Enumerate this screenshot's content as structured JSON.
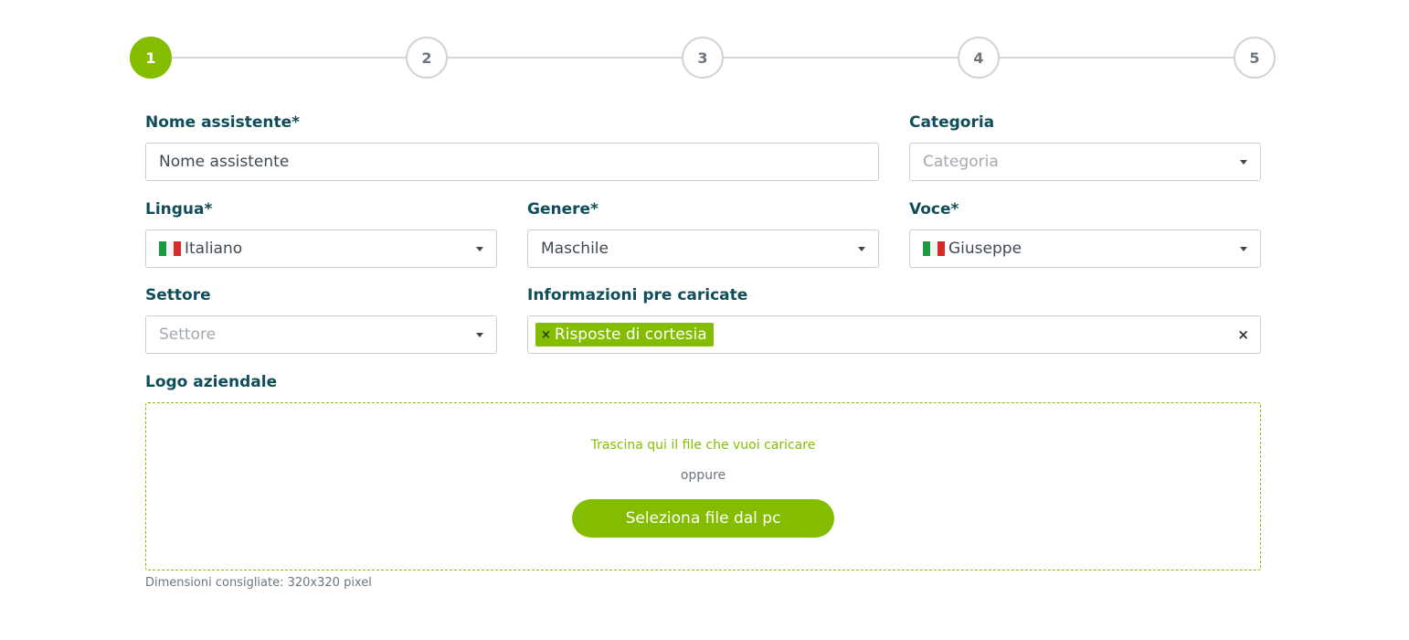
{
  "stepper": {
    "steps": [
      "1",
      "2",
      "3",
      "4",
      "5"
    ],
    "active_step": 1,
    "accent_color": "#84bd00"
  },
  "form": {
    "nome": {
      "label": "Nome assistente*",
      "value": "Nome assistente"
    },
    "categoria": {
      "label": "Categoria",
      "placeholder": "Categoria"
    },
    "lingua": {
      "label": "Lingua*",
      "value": "Italiano",
      "icon": "italy-flag-icon"
    },
    "genere": {
      "label": "Genere*",
      "value": "Maschile"
    },
    "voce": {
      "label": "Voce*",
      "value": "Giuseppe",
      "icon": "italy-flag-icon"
    },
    "settore": {
      "label": "Settore",
      "placeholder": "Settore"
    },
    "informazioni": {
      "label": "Informazioni pre caricate",
      "tags": [
        "Risposte di cortesia"
      ],
      "remove_symbol": "×",
      "clear_symbol": "×"
    },
    "logo": {
      "label": "Logo aziendale",
      "drop_text": "Trascina qui il file che vuoi caricare",
      "or_text": "oppure",
      "button_label": "Seleziona file dal pc",
      "hint": "Dimensioni consigliate: 320x320 pixel"
    }
  }
}
